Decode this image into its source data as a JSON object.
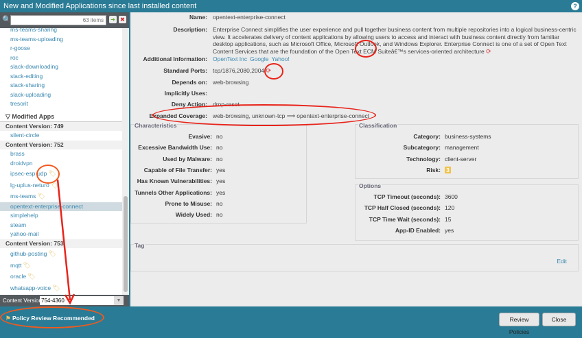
{
  "title": "New and Modified Applications since last installed content",
  "search": {
    "placeholder": "63 items"
  },
  "new_apps": [
    "ms-teams-sharing",
    "ms-teams-uploading",
    "r-goose",
    "roc",
    "slack-downloading",
    "slack-editing",
    "slack-sharing",
    "slack-uploading",
    "tresorit"
  ],
  "modified_header": "Modified Apps",
  "groups": [
    {
      "label": "Content Version: 749",
      "apps": [
        {
          "name": "silent-circle"
        }
      ]
    },
    {
      "label": "Content Version: 752",
      "apps": [
        {
          "name": "brass"
        },
        {
          "name": "droidvpn"
        },
        {
          "name": "ipsec-esp-udp",
          "tag": true
        },
        {
          "name": "lg-uplus-neturo",
          "tag": true
        },
        {
          "name": "ms-teams",
          "tag": true
        },
        {
          "name": "opentext-enterprise-connect",
          "selected": true
        },
        {
          "name": "simplehelp"
        },
        {
          "name": "steam"
        },
        {
          "name": "yahoo-mail"
        }
      ]
    },
    {
      "label": "Content Version: 753",
      "apps": [
        {
          "name": "github-posting",
          "tag": true
        },
        {
          "name": "mqtt",
          "tag": true
        },
        {
          "name": "oracle",
          "tag": true
        },
        {
          "name": "whatsapp-voice",
          "tag": true
        }
      ]
    }
  ],
  "content_version": {
    "label": "Content Version:",
    "value": "754-4360"
  },
  "details": {
    "name_label": "Name:",
    "name": "opentext-enterprise-connect",
    "desc_label": "Description:",
    "description": "Enterprise Connect simplifies the user experience and pull together business content from multiple repositories into a logical business-centric view. It accelerates delivery of content applications by allowing users to access and interact with business content directly from familiar desktop applications, such as Microsoft Office, Microsoft Outlook, and Windows Explorer. Enterprise Connect is one of a set of Open Text Content Services that are the foundation of the Open Text ECM Suiteâ€™s services-oriented architecture",
    "addl_label": "Additional Information:",
    "links": [
      "OpenText Inc",
      "Google",
      "Yahoo!"
    ],
    "ports_label": "Standard Ports:",
    "ports": "tcp/1876,2080,2004",
    "depends_label": "Depends on:",
    "depends": "web-browsing",
    "implicit_label": "Implicitly Uses:",
    "implicit": "",
    "deny_label": "Deny Action:",
    "deny": "drop-reset",
    "expanded_label": "Expanded Coverage:",
    "expanded_from": "web-browsing, unknown-tcp",
    "expanded_to": "opentext-enterprise-connect"
  },
  "characteristics": {
    "title": "Characteristics",
    "items": [
      {
        "k": "Evasive:",
        "v": "no"
      },
      {
        "k": "Excessive Bandwidth Use:",
        "v": "no"
      },
      {
        "k": "Used by Malware:",
        "v": "no"
      },
      {
        "k": "Capable of File Transfer:",
        "v": "yes"
      },
      {
        "k": "Has Known Vulnerabilities:",
        "v": "yes"
      },
      {
        "k": "Tunnels Other Applications:",
        "v": "yes"
      },
      {
        "k": "Prone to Misuse:",
        "v": "no"
      },
      {
        "k": "Widely Used:",
        "v": "no"
      }
    ]
  },
  "classification": {
    "title": "Classification",
    "items": [
      {
        "k": "Category:",
        "v": "business-systems"
      },
      {
        "k": "Subcategory:",
        "v": "management"
      },
      {
        "k": "Technology:",
        "v": "client-server"
      }
    ],
    "risk_label": "Risk:",
    "risk": "3"
  },
  "options": {
    "title": "Options",
    "items": [
      {
        "k": "TCP Timeout (seconds):",
        "v": "3600"
      },
      {
        "k": "TCP Half Closed (seconds):",
        "v": "120"
      },
      {
        "k": "TCP Time Wait (seconds):",
        "v": "15"
      },
      {
        "k": "App-ID Enabled:",
        "v": "yes"
      }
    ]
  },
  "tag": {
    "title": "Tag",
    "edit": "Edit"
  },
  "footer": {
    "policy_review": "Policy Review Recommended",
    "review_button": "Review Policies",
    "close_button": "Close"
  }
}
